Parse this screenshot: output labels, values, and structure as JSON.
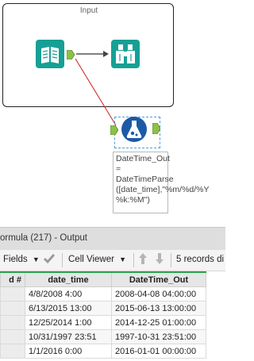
{
  "canvas": {
    "container_title": "Input",
    "formula_annotation": "DateTime_Out = DateTimeParse ([date_time],\"%m/%d/%Y %k:%M\")",
    "colors": {
      "accent": "#1a9ba1",
      "anchor": "#8cc04b",
      "connection_error": "#d11a1a",
      "connection": "#555555"
    }
  },
  "output": {
    "title": "ormula (217) - Output"
  },
  "toolbar": {
    "fields_label": "Fields",
    "cell_viewer_label": "Cell Viewer",
    "records_text": "5 records di"
  },
  "table": {
    "headers": [
      "d #",
      "date_time",
      "DateTime_Out"
    ],
    "rows": [
      [
        "",
        "4/8/2008 4:00",
        "2008-04-08 04:00:00"
      ],
      [
        "",
        "6/13/2015 13:00",
        "2015-06-13 13:00:00"
      ],
      [
        "",
        "12/25/2014 1:00",
        "2014-12-25 01:00:00"
      ],
      [
        "",
        "10/31/1997 23:51",
        "1997-10-31 23:51:00"
      ],
      [
        "",
        "1/1/2016 0:00",
        "2016-01-01 00:00:00"
      ]
    ]
  }
}
